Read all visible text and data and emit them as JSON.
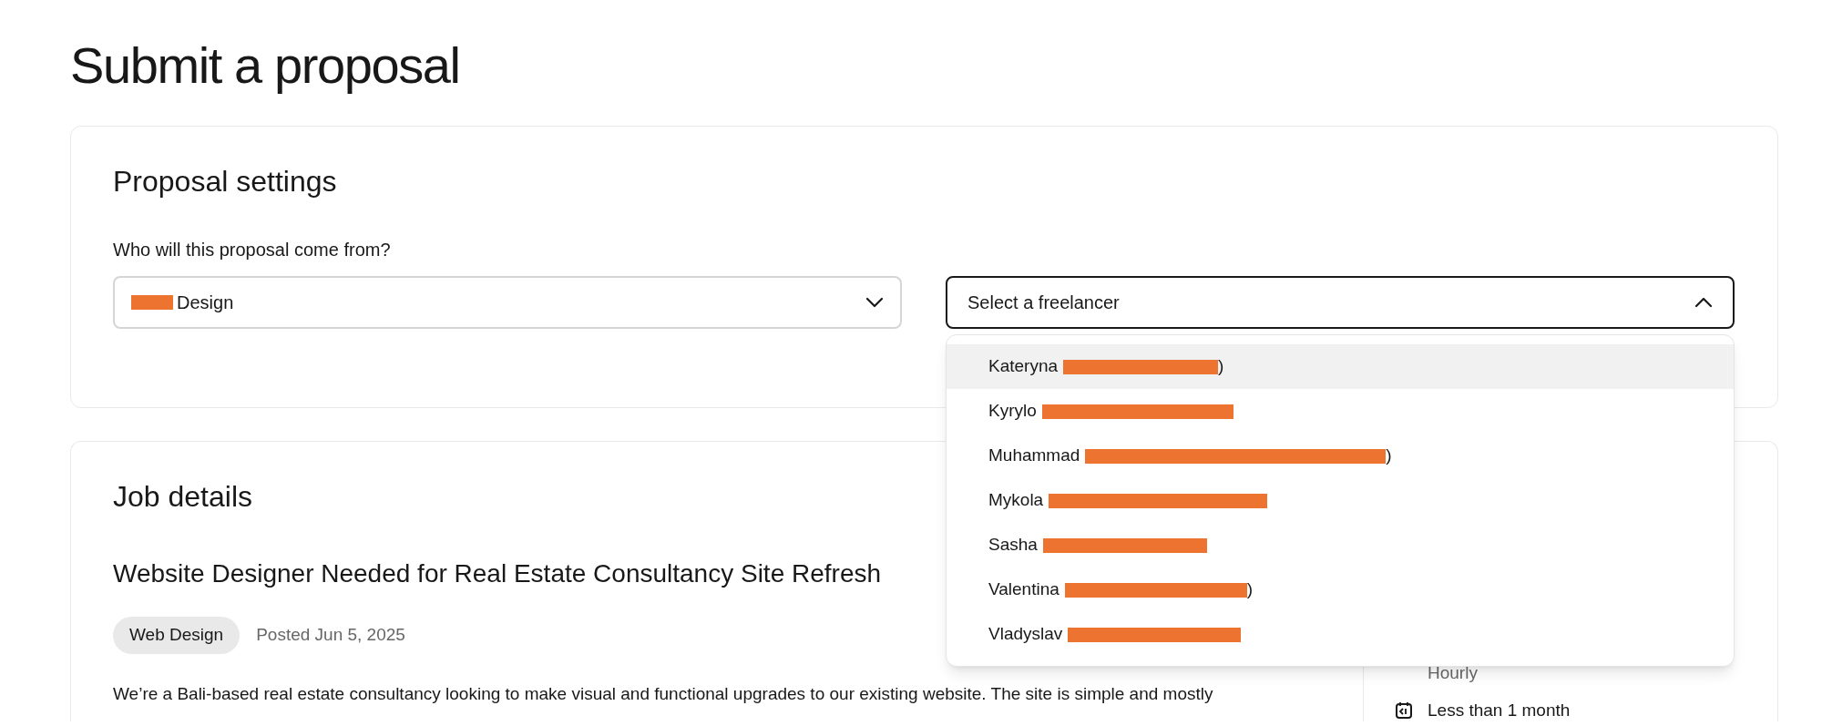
{
  "page_title": "Submit a proposal",
  "proposal_settings": {
    "title": "Proposal settings",
    "question": "Who will this proposal come from?",
    "agency_select": {
      "value": "Design",
      "redacted": true,
      "expanded": false
    },
    "freelancer_select": {
      "placeholder": "Select a freelancer",
      "expanded": true,
      "options": [
        {
          "label": "Kateryna",
          "suffix": ")",
          "selected": true
        },
        {
          "label": "Kyrylo",
          "selected": false
        },
        {
          "label": "Muhammad",
          "suffix": ")",
          "selected": false
        },
        {
          "label": "Mykola",
          "selected": false
        },
        {
          "label": "Sasha",
          "selected": false
        },
        {
          "label": "Valentina",
          "suffix": ")",
          "selected": false
        },
        {
          "label": "Vladyslav",
          "selected": false
        }
      ]
    }
  },
  "job_details": {
    "title": "Job details",
    "job_title": "Website Designer Needed for Real Estate Consultancy Site Refresh",
    "tag": "Web Design",
    "posted": "Posted Jun 5, 2025",
    "description": "We’re a Bali-based real estate consultancy looking to make visual and functional upgrades to our existing website. The site is simple and mostly",
    "side": [
      {
        "kind": "text",
        "label": "Hourly"
      },
      {
        "kind": "duration",
        "label": "Less than 1 month"
      }
    ]
  }
}
